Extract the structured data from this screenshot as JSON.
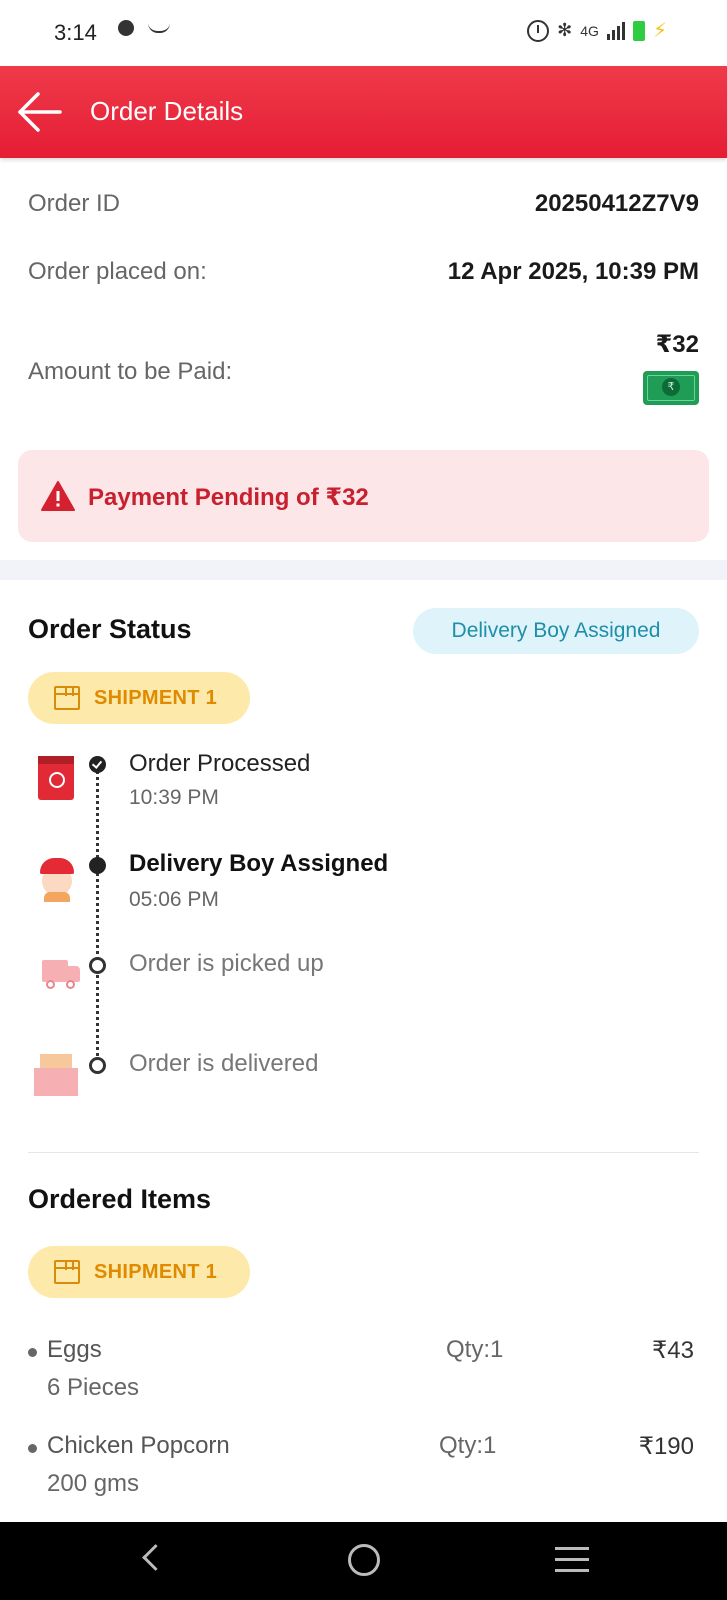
{
  "status_bar": {
    "time": "3:14",
    "network": "4G"
  },
  "header": {
    "title": "Order Details"
  },
  "order_info": {
    "order_id_label": "Order ID",
    "order_id_value": "20250412Z7V9",
    "placed_label": "Order placed on:",
    "placed_value": "12 Apr 2025, 10:39 PM",
    "amount_label": "Amount to be Paid:",
    "amount_value": "₹32",
    "payment_icon": "cash-note-icon"
  },
  "payment_alert": {
    "text": "Payment Pending of ₹32",
    "icon": "warning-icon",
    "color": "#c8202f"
  },
  "order_status": {
    "title": "Order Status",
    "status_badge": "Delivery Boy Assigned",
    "shipment_label": "SHIPMENT 1",
    "steps": [
      {
        "title": "Order Processed",
        "time": "10:39 PM",
        "icon": "bag-icon"
      },
      {
        "title": "Delivery Boy Assigned",
        "time": "05:06 PM",
        "icon": "delivery-boy-icon"
      },
      {
        "title": "Order is picked up",
        "icon": "truck-icon"
      },
      {
        "title": "Order is delivered",
        "icon": "parcel-icon"
      }
    ]
  },
  "ordered_items": {
    "title": "Ordered Items",
    "shipment_label": "SHIPMENT 1",
    "items": [
      {
        "name": "Eggs",
        "variant": "6 Pieces",
        "qty": "Qty:1",
        "price": "₹43"
      },
      {
        "name": "Chicken Popcorn",
        "variant": "200 gms",
        "qty": "Qty:1",
        "price": "₹190"
      }
    ]
  },
  "colors": {
    "brand_red": "#e51d34",
    "shipment_chip": "#fde9a9",
    "status_pill": "#dff3fb"
  }
}
